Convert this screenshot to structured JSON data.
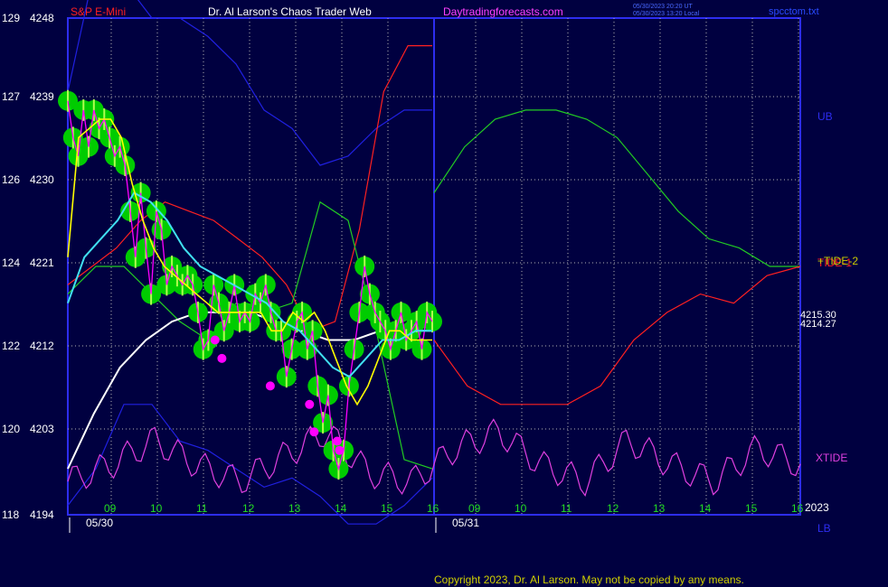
{
  "header": {
    "symbol": "S&P E-Mini",
    "site_title": "Dr. Al Larson's Chaos Trader Web",
    "url": "Daytradingforecasts.com",
    "update_line1": "05/30/2023 20:20 UT",
    "update_line2": "05/30/2023 13:20 Local",
    "filename": "spcctom.txt"
  },
  "footer": {
    "copyright": "Copyright 2023, Dr. Al Larson. May not be copied by any means."
  },
  "colors": {
    "background": "#000040",
    "frame": "#2d2df0",
    "grid": "#b4b4b4",
    "price_fill": "#00cc00",
    "price_bars": "#b0ff50",
    "magenta": "#ff00ff",
    "yellow": "#ffff00",
    "cyan": "#40e0f0",
    "white": "#ffffff",
    "red": "#ff2020",
    "green": "#22cc22",
    "blue": "#2020e0",
    "xtide": "#e040e0"
  },
  "chart_data": {
    "type": "line",
    "title": "S&P E-Mini",
    "y_left_inner": [
      "129",
      "127",
      "126",
      "124",
      "122",
      "120",
      "118"
    ],
    "y_left_outer": [
      "4248",
      "4239",
      "4230",
      "4221",
      "4212",
      "4203",
      "4194"
    ],
    "ylim": [
      4194,
      4248
    ],
    "x_hour_labels": [
      "09",
      "10",
      "11",
      "12",
      "13",
      "14",
      "15",
      "16",
      "09",
      "10",
      "11",
      "12",
      "13",
      "14",
      "15",
      "16"
    ],
    "x_date_labels": [
      "05/30",
      "05/31"
    ],
    "year_label": "2023",
    "right_labels": {
      "ub": "UB",
      "lb": "LB",
      "tide": "+TIDE-2",
      "tide1": "TIDE-1",
      "xtide": "XTIDE",
      "price_high": "4215.30",
      "price_low": "4214.27"
    },
    "series": [
      {
        "name": "Price",
        "values": [
          4239,
          4235,
          4233,
          4238,
          4234,
          4238,
          4236,
          4237,
          4235,
          4233,
          4234,
          4232,
          4227,
          4222,
          4229,
          4223,
          4218,
          4227,
          4225,
          4219,
          4221,
          4220,
          4219,
          4220,
          4219,
          4216,
          4212,
          4213,
          4219,
          4217,
          4214,
          4216,
          4219,
          4215,
          4216,
          4215,
          4218,
          4217,
          4219,
          4216,
          4214,
          4214,
          4209,
          4212,
          4215,
          4216,
          4212,
          4214,
          4208,
          4204,
          4207,
          4201,
          4199,
          4201,
          4208,
          4212,
          4216,
          4221,
          4218,
          4216,
          4215,
          4214,
          4212,
          4214,
          4216,
          4213,
          4214,
          4215,
          4212,
          4216,
          4215
        ]
      },
      {
        "name": "Yellow",
        "values": [
          4222,
          4235,
          4236,
          4237,
          4237,
          4235,
          4230,
          4226,
          4223,
          4221,
          4220,
          4219,
          4218,
          4217,
          4216,
          4216,
          4216,
          4216,
          4216,
          4214,
          4214,
          4216,
          4215,
          4216,
          4214,
          4211,
          4208,
          4206,
          4208,
          4211,
          4214,
          4214,
          4213,
          4213,
          4213
        ]
      },
      {
        "name": "Cyan",
        "values": [
          4217,
          4222,
          4224,
          4226,
          4229,
          4228,
          4226,
          4223,
          4221,
          4220,
          4219,
          4218,
          4217,
          4215,
          4214,
          4212,
          4210,
          4209,
          4211,
          4213,
          4213,
          4214,
          4214
        ]
      },
      {
        "name": "White",
        "values": [
          4199,
          4205,
          4210,
          4213,
          4215,
          4216,
          4216,
          4216,
          4215,
          4214,
          4213,
          4213,
          4214,
          4214,
          4214
        ]
      },
      {
        "name": "Red",
        "values": [
          4219,
          4221,
          4223,
          4226,
          4228,
          4227,
          4226,
          4224,
          4222,
          4219,
          4214,
          4215,
          4225,
          4240,
          4245,
          4245
        ]
      },
      {
        "name": "Green",
        "values": [
          4218,
          4221,
          4221,
          4218,
          4215,
          4213,
          4217,
          4216,
          4217,
          4228,
          4226,
          4214,
          4200,
          4199
        ]
      },
      {
        "name": "UB",
        "values": [
          4240,
          4254,
          4252,
          4248,
          4248,
          4246,
          4243,
          4238,
          4236,
          4232,
          4233,
          4236,
          4238,
          4238
        ]
      },
      {
        "name": "LB",
        "values": [
          4195,
          4199,
          4206,
          4206,
          4202,
          4201,
          4199,
          4197,
          4198,
          4196,
          4193,
          4193,
          4195,
          4198
        ]
      },
      {
        "name": "Forecast green",
        "values": [
          4229,
          4234,
          4237,
          4238,
          4238,
          4237,
          4235,
          4231,
          4227,
          4224,
          4223,
          4221,
          4221
        ]
      },
      {
        "name": "Forecast red",
        "values": [
          4213,
          4208,
          4206,
          4206,
          4206,
          4208,
          4213,
          4216,
          4218,
          4217,
          4220,
          4221
        ]
      },
      {
        "name": "XTIDE",
        "values": [
          118.8,
          119.2,
          119.8,
          119.2,
          118.8,
          119.4,
          120.0,
          119.0,
          118.8,
          119.6,
          120.0,
          119.2,
          118.8,
          119.8,
          119.2,
          118.8,
          119.6,
          119.2
        ]
      }
    ],
    "marker_points": [
      [
        11.25,
        4213
      ],
      [
        11.4,
        4211
      ],
      [
        12.45,
        4208
      ],
      [
        13.3,
        4206
      ],
      [
        13.4,
        4203
      ],
      [
        13.9,
        4202
      ],
      [
        13.95,
        4201
      ]
    ]
  }
}
